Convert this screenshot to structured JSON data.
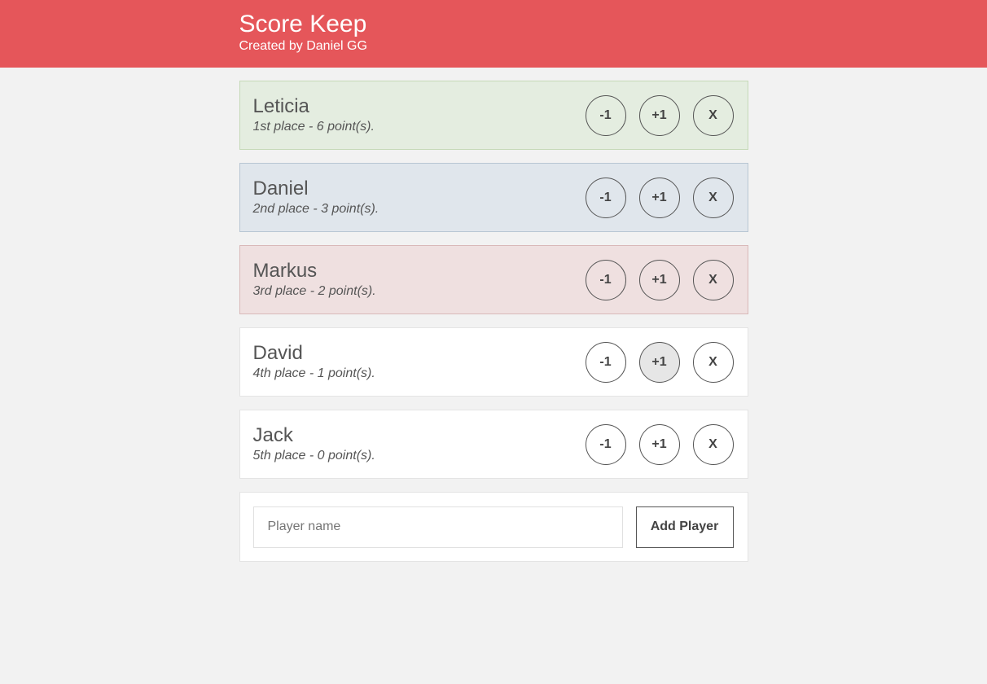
{
  "header": {
    "title": "Score Keep",
    "subtitle": "Created by Daniel GG"
  },
  "players": [
    {
      "name": "Leticia",
      "stats": "1st place - 6 point(s).",
      "minus_label": "-1",
      "plus_label": "+1",
      "remove_label": "X"
    },
    {
      "name": "Daniel",
      "stats": "2nd place - 3 point(s).",
      "minus_label": "-1",
      "plus_label": "+1",
      "remove_label": "X"
    },
    {
      "name": "Markus",
      "stats": "3rd place - 2 point(s).",
      "minus_label": "-1",
      "plus_label": "+1",
      "remove_label": "X"
    },
    {
      "name": "David",
      "stats": "4th place - 1 point(s).",
      "minus_label": "-1",
      "plus_label": "+1",
      "remove_label": "X"
    },
    {
      "name": "Jack",
      "stats": "5th place - 0 point(s).",
      "minus_label": "-1",
      "plus_label": "+1",
      "remove_label": "X"
    }
  ],
  "add_form": {
    "input_value": "",
    "input_placeholder": "Player name",
    "button_label": "Add Player"
  },
  "colors": {
    "header_bg": "#e5565a",
    "first_place_bg": "#e4ede0",
    "second_place_bg": "#e0e6ec",
    "third_place_bg": "#efe0e0",
    "page_bg": "#f2f2f2"
  }
}
